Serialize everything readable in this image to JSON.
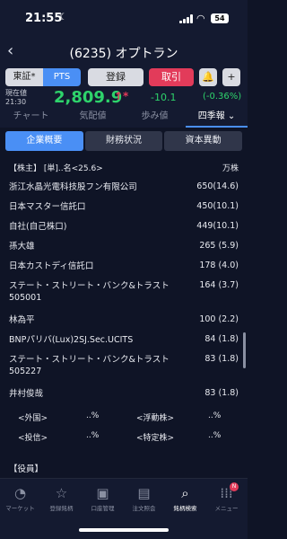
{
  "status": {
    "time": "21:55",
    "battery": "54"
  },
  "nav": {
    "title": "(6235) オプトラン"
  },
  "controls": {
    "market_a": "東証*",
    "market_b": "PTS",
    "register": "登録",
    "trade": "取引",
    "bell": "🔔",
    "plus": "+"
  },
  "price": {
    "label_line1": "現在値",
    "label_line2": "21:30",
    "value": "2,809.9",
    "arrow": "↑*",
    "change": "-10.1",
    "change_pct": "(-0.36%)"
  },
  "tabs": [
    "チャート",
    "気配値",
    "歩み値",
    "四季報 ⌄"
  ],
  "subtabs": [
    "企業概要",
    "財務状況",
    "資本異動"
  ],
  "shareholders": {
    "header": "【株主】 [単]..名<25.6>",
    "unit": "万株",
    "rows": [
      {
        "name": "浙江水晶光電科技股フン有限公司",
        "value": "650(14.6)"
      },
      {
        "name": "日本マスター信託口",
        "value": "450(10.1)"
      },
      {
        "name": "自社(自己株口)",
        "value": "449(10.1)"
      },
      {
        "name": "孫大雄",
        "value": "265 (5.9)"
      },
      {
        "name": "日本カストディ信託口",
        "value": "178 (4.0)"
      },
      {
        "name": "ステート・ストリート・バンク&トラスト505001",
        "value": "164 (3.7)"
      },
      {
        "name": "林為平",
        "value": "100 (2.2)"
      },
      {
        "name": "BNPパリバ(Lux)2SJ.Sec.UCITS",
        "value": "84 (1.8)"
      },
      {
        "name": "ステート・ストリート・バンク&トラスト505227",
        "value": "83 (1.8)"
      },
      {
        "name": "井村俊哉",
        "value": "83 (1.8)"
      }
    ],
    "foreign_label": "<外国>",
    "foreign_val": "..%",
    "float_label": "<浮動株>",
    "float_val": "..%",
    "invest_label": "<投信>",
    "invest_val": "..%",
    "specific_label": "<特定株>",
    "specific_val": "..%"
  },
  "officers": {
    "header": "【役員】"
  },
  "bottom": [
    {
      "icon": "◔",
      "label": "マーケット"
    },
    {
      "icon": "☆",
      "label": "登録銘柄"
    },
    {
      "icon": "▣",
      "label": "口座管理"
    },
    {
      "icon": "▤",
      "label": "注文照会"
    },
    {
      "icon": "⌕",
      "label": "銘柄検索"
    },
    {
      "icon": "⁞⁞⁞",
      "label": "メニュー"
    }
  ],
  "bottom_badge": "N"
}
